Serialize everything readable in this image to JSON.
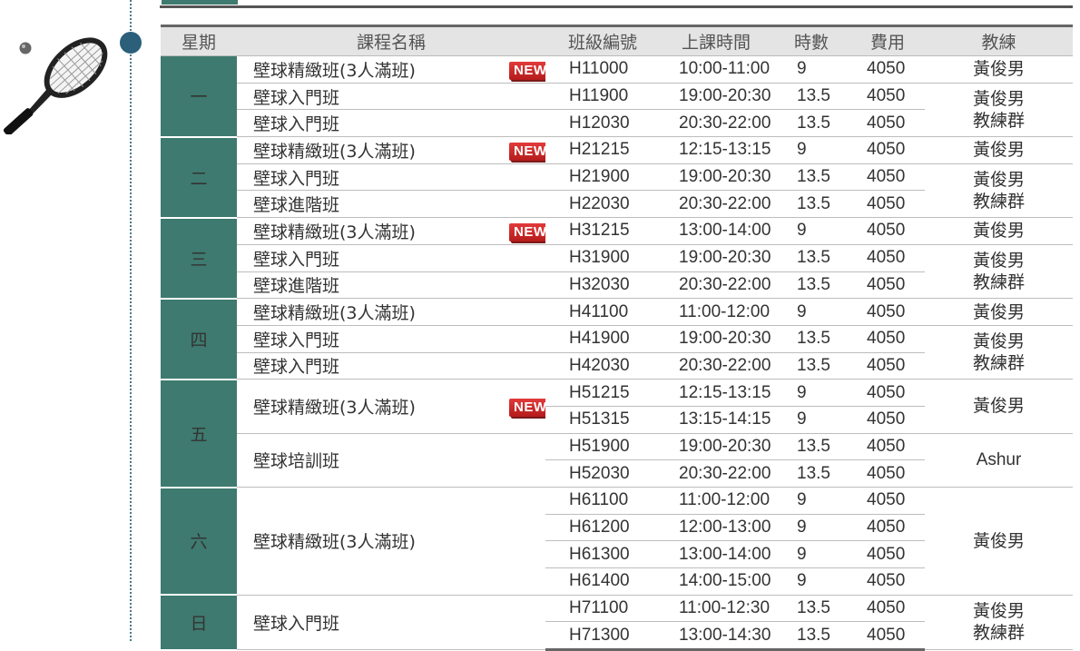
{
  "table": {
    "headers": [
      "星期",
      "課程名稱",
      "班級編號",
      "上課時間",
      "時數",
      "費用",
      "教練"
    ],
    "badge_label": "NEW",
    "days": [
      {
        "day": "一",
        "rows": [
          {
            "name": "壁球精緻班(3人滿班)",
            "new": true,
            "code": "H11000",
            "time": "10:00-11:00",
            "hours": "9",
            "fee": "4050",
            "coach": "黃俊男"
          },
          {
            "name": "壁球入門班",
            "new": false,
            "code": "H11900",
            "time": "19:00-20:30",
            "hours": "13.5",
            "fee": "4050",
            "coach": "黃俊男\n教練群"
          },
          {
            "name": "壁球入門班",
            "new": false,
            "code": "H12030",
            "time": "20:30-22:00",
            "hours": "13.5",
            "fee": "4050"
          }
        ]
      },
      {
        "day": "二",
        "rows": [
          {
            "name": "壁球精緻班(3人滿班)",
            "new": true,
            "code": "H21215",
            "time": "12:15-13:15",
            "hours": "9",
            "fee": "4050",
            "coach": "黃俊男"
          },
          {
            "name": "壁球入門班",
            "new": false,
            "code": "H21900",
            "time": "19:00-20:30",
            "hours": "13.5",
            "fee": "4050",
            "coach": "黃俊男\n教練群"
          },
          {
            "name": "壁球進階班",
            "new": false,
            "code": "H22030",
            "time": "20:30-22:00",
            "hours": "13.5",
            "fee": "4050"
          }
        ]
      },
      {
        "day": "三",
        "rows": [
          {
            "name": "壁球精緻班(3人滿班)",
            "new": true,
            "code": "H31215",
            "time": "13:00-14:00",
            "hours": "9",
            "fee": "4050",
            "coach": "黃俊男"
          },
          {
            "name": "壁球入門班",
            "new": false,
            "code": "H31900",
            "time": "19:00-20:30",
            "hours": "13.5",
            "fee": "4050",
            "coach": "黃俊男\n教練群"
          },
          {
            "name": "壁球進階班",
            "new": false,
            "code": "H32030",
            "time": "20:30-22:00",
            "hours": "13.5",
            "fee": "4050"
          }
        ]
      },
      {
        "day": "四",
        "rows": [
          {
            "name": "壁球精緻班(3人滿班)",
            "new": false,
            "code": "H41100",
            "time": "11:00-12:00",
            "hours": "9",
            "fee": "4050",
            "coach": "黃俊男"
          },
          {
            "name": "壁球入門班",
            "new": false,
            "code": "H41900",
            "time": "19:00-20:30",
            "hours": "13.5",
            "fee": "4050",
            "coach": "黃俊男\n教練群"
          },
          {
            "name": "壁球入門班",
            "new": false,
            "code": "H42030",
            "time": "20:30-22:00",
            "hours": "13.5",
            "fee": "4050"
          }
        ]
      },
      {
        "day": "五",
        "rows": [
          {
            "name": "壁球精緻班(3人滿班)",
            "new": true,
            "code": "H51215",
            "time": "12:15-13:15",
            "hours": "9",
            "fee": "4050",
            "coach": "黃俊男"
          },
          {
            "code": "H51315",
            "time": "13:15-14:15",
            "hours": "9",
            "fee": "4050"
          },
          {
            "name": "壁球培訓班",
            "new": false,
            "code": "H51900",
            "time": "19:00-20:30",
            "hours": "13.5",
            "fee": "4050",
            "coach": "Ashur"
          },
          {
            "code": "H52030",
            "time": "20:30-22:00",
            "hours": "13.5",
            "fee": "4050"
          }
        ]
      },
      {
        "day": "六",
        "rows": [
          {
            "name": "壁球精緻班(3人滿班)",
            "new": false,
            "code": "H61100",
            "time": "11:00-12:00",
            "hours": "9",
            "fee": "4050",
            "coach": "黃俊男"
          },
          {
            "code": "H61200",
            "time": "12:00-13:00",
            "hours": "9",
            "fee": "4050"
          },
          {
            "code": "H61300",
            "time": "13:00-14:00",
            "hours": "9",
            "fee": "4050"
          },
          {
            "code": "H61400",
            "time": "14:00-15:00",
            "hours": "9",
            "fee": "4050"
          }
        ]
      },
      {
        "day": "日",
        "rows": [
          {
            "name": "壁球入門班",
            "new": false,
            "code": "H71100",
            "time": "11:00-12:30",
            "hours": "13.5",
            "fee": "4050",
            "coach": "黃俊男\n教練群"
          },
          {
            "code": "H71300",
            "time": "13:00-14:30",
            "hours": "13.5",
            "fee": "4050"
          }
        ]
      }
    ]
  },
  "colors": {
    "day_cell": "#3e7a6f",
    "header_bg": "#e4e4e4",
    "badge": "#d42a2a",
    "timeline": "#2b5f7a"
  },
  "icons": {
    "decoration": "tennis-racket-icon"
  }
}
